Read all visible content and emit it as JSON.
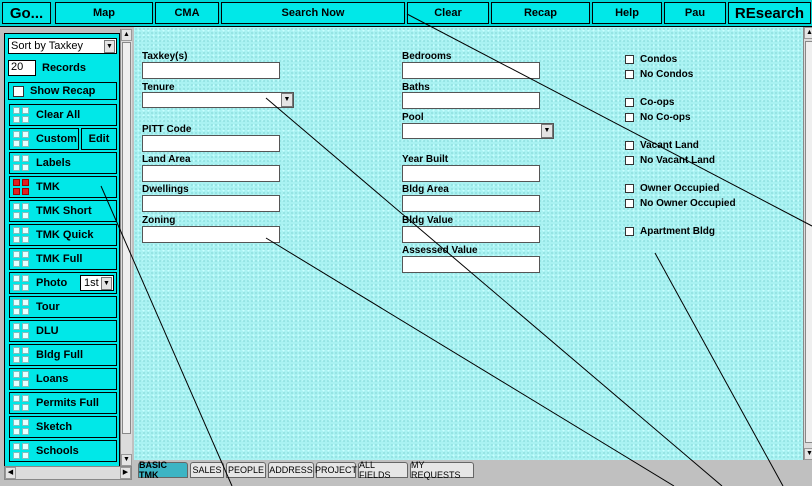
{
  "toolbar": {
    "go": "Go...",
    "map": "Map",
    "cma": "CMA",
    "search_now": "Search Now",
    "clear": "Clear",
    "recap": "Recap",
    "help": "Help",
    "pau": "Pau",
    "research": "REsearch"
  },
  "sidebar": {
    "sort_select": "Sort by Taxkey",
    "records_value": "20",
    "records_label": "Records",
    "show_recap": "Show Recap",
    "clear_all": "Clear All",
    "custom": "Custom",
    "edit": "Edit",
    "labels": "Labels",
    "tmk": "TMK",
    "tmk_short": "TMK Short",
    "tmk_quick": "TMK Quick",
    "tmk_full": "TMK Full",
    "photo": "Photo",
    "photo_select": "1st",
    "tour": "Tour",
    "dlu": "DLU",
    "bldg_full": "Bldg Full",
    "loans": "Loans",
    "permits_full": "Permits Full",
    "sketch": "Sketch",
    "schools": "Schools"
  },
  "form": {
    "taxkeys": "Taxkey(s)",
    "tenure": "Tenure",
    "pitt_code": "PITT Code",
    "land_area": "Land Area",
    "dwellings": "Dwellings",
    "zoning": "Zoning",
    "bedrooms": "Bedrooms",
    "baths": "Baths",
    "pool": "Pool",
    "year_built": "Year Built",
    "bldg_area": "Bldg Area",
    "bldg_value": "Bldg Value",
    "assessed_value": "Assessed Value"
  },
  "checks": {
    "condos": "Condos",
    "no_condos": "No Condos",
    "coops": "Co-ops",
    "no_coops": "No Co-ops",
    "vacant_land": "Vacant Land",
    "no_vacant_land": "No Vacant Land",
    "owner_occupied": "Owner Occupied",
    "no_owner_occupied": "No Owner Occupied",
    "apartment_bldg": "Apartment Bldg"
  },
  "tabs": [
    "BASIC TMK",
    "SALES",
    "PEOPLE",
    "ADDRESS",
    "PROJECT",
    "ALL FIELDS",
    "MY REQUESTS"
  ]
}
